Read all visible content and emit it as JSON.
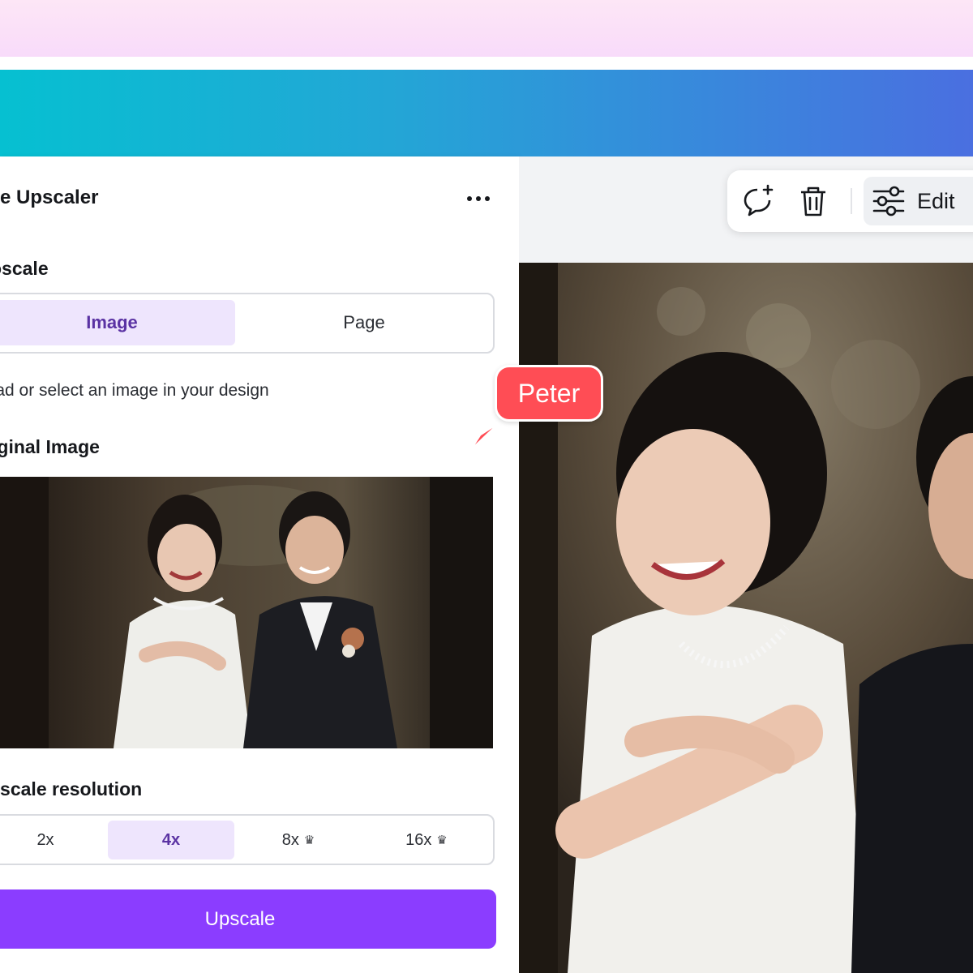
{
  "panel": {
    "title": "age Upscaler",
    "more_label": "More options",
    "upscale_section": {
      "label": "oscale",
      "options": [
        {
          "label": "Image",
          "active": true
        },
        {
          "label": "Page",
          "active": false
        }
      ]
    },
    "hint": "load or select an image in your design",
    "original_image_label": "iginal Image",
    "resolution_section": {
      "label": "oscale resolution",
      "options": [
        {
          "label": "2x",
          "active": false,
          "pro": false
        },
        {
          "label": "4x",
          "active": true,
          "pro": false
        },
        {
          "label": "8x",
          "active": false,
          "pro": true
        },
        {
          "label": "16x",
          "active": false,
          "pro": true
        }
      ]
    },
    "upscale_button": "Upscale"
  },
  "toolbar": {
    "icons": [
      "comment-add-icon",
      "trash-icon",
      "sliders-icon"
    ],
    "edit_label": "Edit"
  },
  "collaborator": {
    "name": "Peter",
    "color": "#ff4d55"
  },
  "colors": {
    "accent": "#8b3dff",
    "segment_active_bg": "#eee5fd",
    "segment_active_text": "#5a32a3"
  }
}
